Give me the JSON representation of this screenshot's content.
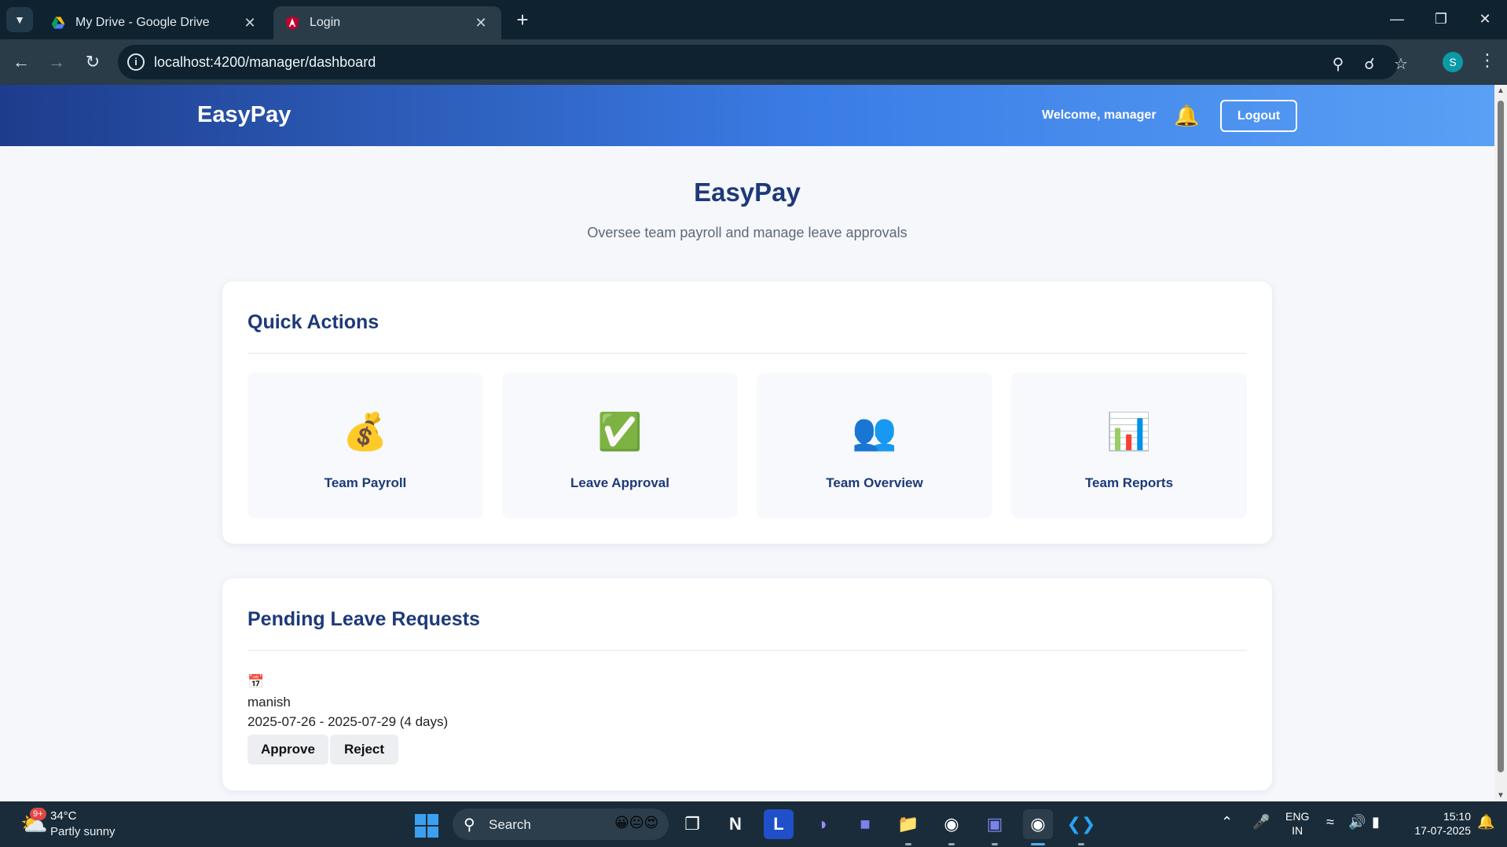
{
  "browser": {
    "tabs": [
      {
        "title": "My Drive - Google Drive",
        "active": false
      },
      {
        "title": "Login",
        "active": true
      }
    ],
    "url": "localhost:4200/manager/dashboard",
    "profile_initial": "S"
  },
  "header": {
    "brand": "EasyPay",
    "welcome": "Welcome, manager",
    "logout_label": "Logout"
  },
  "hero": {
    "title": "EasyPay",
    "subtitle": "Oversee team payroll and manage leave approvals"
  },
  "quick_actions": {
    "title": "Quick Actions",
    "items": [
      {
        "label": "Team Payroll",
        "icon": "money-bag-icon"
      },
      {
        "label": "Leave Approval",
        "icon": "check-box-icon"
      },
      {
        "label": "Team Overview",
        "icon": "people-icon"
      },
      {
        "label": "Team Reports",
        "icon": "bar-chart-icon"
      }
    ]
  },
  "pending_leave": {
    "title": "Pending Leave Requests",
    "requests": [
      {
        "name": "manish",
        "dates": "2025-07-26 - 2025-07-29 (4 days)",
        "approve_label": "Approve",
        "reject_label": "Reject"
      }
    ]
  },
  "taskbar": {
    "weather_badge": "9+",
    "temperature": "34°C",
    "condition": "Partly sunny",
    "search_placeholder": "Search",
    "language": "ENG",
    "region": "IN",
    "time": "15:10",
    "date": "17-07-2025"
  },
  "colors": {
    "header_gradient_start": "#1e3c8c",
    "header_gradient_end": "#5aa0f5",
    "title_navy": "#1d3978",
    "page_bg": "#f5f7fb"
  }
}
